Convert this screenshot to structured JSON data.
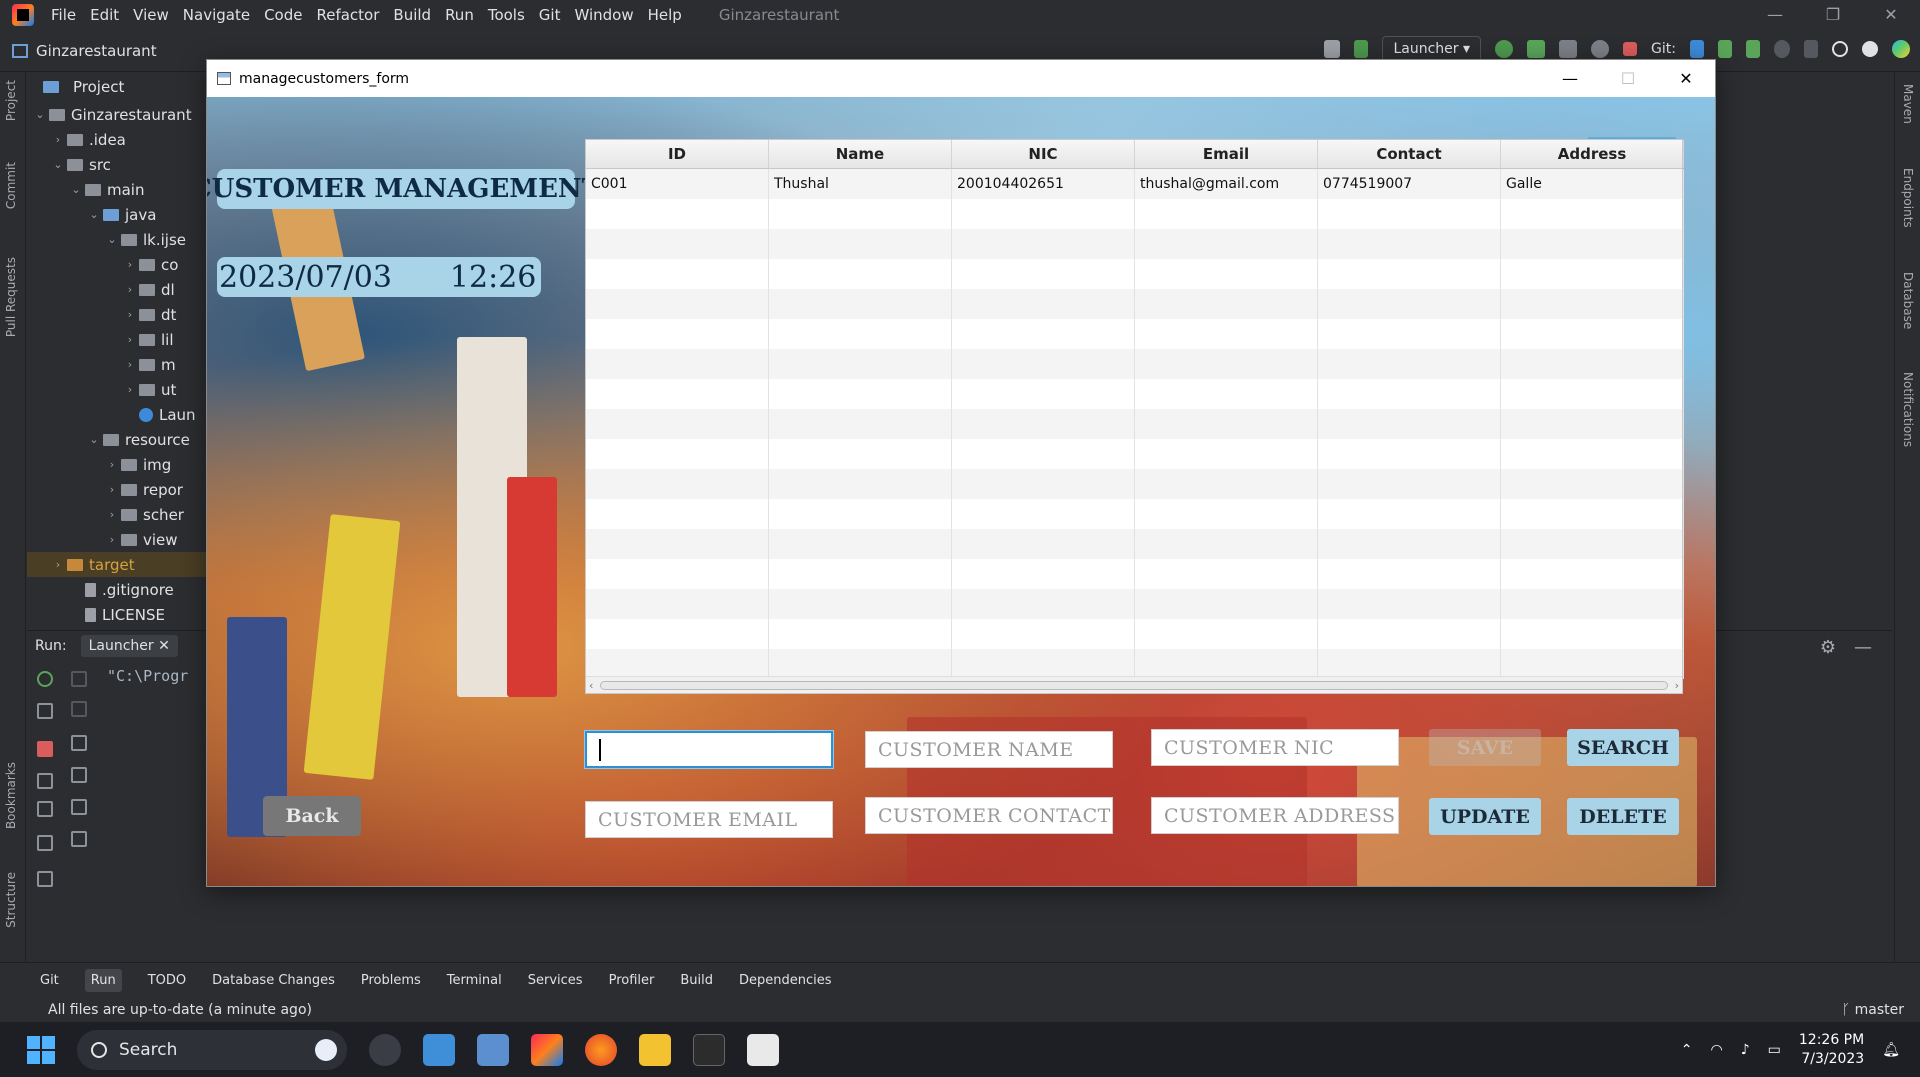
{
  "ide": {
    "menu": [
      "File",
      "Edit",
      "View",
      "Navigate",
      "Code",
      "Refactor",
      "Build",
      "Run",
      "Tools",
      "Git",
      "Window",
      "Help"
    ],
    "window_title": "Ginzarestaurant",
    "project_name": "Ginzarestaurant",
    "run_config": "Launcher",
    "git_label": "Git:",
    "project_tab": "Project",
    "left_stripe": [
      "Project",
      "Commit",
      "Pull Requests",
      "Bookmarks",
      "Structure"
    ],
    "right_stripe": [
      "Maven",
      "Endpoints",
      "Database",
      "Notifications"
    ],
    "tree": [
      {
        "label": "Ginzarestaurant",
        "indent": 0,
        "arrow": "v",
        "icon": "folder"
      },
      {
        "label": ".idea",
        "indent": 1,
        "arrow": ">",
        "icon": "folder"
      },
      {
        "label": "src",
        "indent": 1,
        "arrow": "v",
        "icon": "folder"
      },
      {
        "label": "main",
        "indent": 2,
        "arrow": "v",
        "icon": "folder"
      },
      {
        "label": "java",
        "indent": 3,
        "arrow": "v",
        "icon": "folder-blue"
      },
      {
        "label": "lk.ijse",
        "indent": 4,
        "arrow": "v",
        "icon": "folder"
      },
      {
        "label": "co",
        "indent": 5,
        "arrow": ">",
        "icon": "folder"
      },
      {
        "label": "dl",
        "indent": 5,
        "arrow": ">",
        "icon": "folder"
      },
      {
        "label": "dt",
        "indent": 5,
        "arrow": ">",
        "icon": "folder"
      },
      {
        "label": "lil",
        "indent": 5,
        "arrow": ">",
        "icon": "folder"
      },
      {
        "label": "m",
        "indent": 5,
        "arrow": ">",
        "icon": "folder"
      },
      {
        "label": "ut",
        "indent": 5,
        "arrow": ">",
        "icon": "folder"
      },
      {
        "label": "Laun",
        "indent": 5,
        "arrow": "",
        "icon": "class"
      },
      {
        "label": "resource",
        "indent": 3,
        "arrow": "v",
        "icon": "folder"
      },
      {
        "label": "img",
        "indent": 4,
        "arrow": ">",
        "icon": "folder"
      },
      {
        "label": "repor",
        "indent": 4,
        "arrow": ">",
        "icon": "folder"
      },
      {
        "label": "scher",
        "indent": 4,
        "arrow": ">",
        "icon": "folder"
      },
      {
        "label": "view",
        "indent": 4,
        "arrow": ">",
        "icon": "folder"
      },
      {
        "label": "target",
        "indent": 1,
        "arrow": ">",
        "icon": "folder-orange"
      },
      {
        "label": ".gitignore",
        "indent": 2,
        "arrow": "",
        "icon": "file"
      },
      {
        "label": "LICENSE",
        "indent": 2,
        "arrow": "",
        "icon": "file"
      }
    ],
    "run_label": "Run:",
    "run_tab": "Launcher",
    "console_text": "\"C:\\Progr",
    "bottom_tabs": [
      "Git",
      "Run",
      "TODO",
      "Database Changes",
      "Problems",
      "Terminal",
      "Services",
      "Profiler",
      "Build",
      "Dependencies"
    ],
    "active_bottom_tab": "Run",
    "status_text": "All files are up-to-date (a minute ago)",
    "branch": "master"
  },
  "taskbar": {
    "search_label": "Search",
    "time": "12:26 PM",
    "date": "7/3/2023"
  },
  "app": {
    "window_title": "managecustomers_form",
    "heading": "CUSTOMER MANAGEMENT",
    "date": "2023/07/03",
    "time": "12:26",
    "table": {
      "columns": [
        "ID",
        "Name",
        "NIC",
        "Email",
        "Contact",
        "Address"
      ],
      "rows": [
        [
          "C001",
          "Thushal",
          "200104402651",
          "thushal@gmail.com",
          "0774519007",
          "Galle"
        ]
      ],
      "empty_rows": 16
    },
    "fields": {
      "id": {
        "placeholder": "",
        "value": ""
      },
      "name": {
        "placeholder": "CUSTOMER NAME"
      },
      "nic": {
        "placeholder": "CUSTOMER NIC"
      },
      "email": {
        "placeholder": "CUSTOMER EMAIL"
      },
      "contact": {
        "placeholder": "CUSTOMER CONTACT"
      },
      "address": {
        "placeholder": "CUSTOMER ADDRESS"
      }
    },
    "buttons": {
      "save": "SAVE",
      "search": "SEARCH",
      "update": "UPDATE",
      "delete": "DELETE",
      "back": "Back"
    }
  }
}
